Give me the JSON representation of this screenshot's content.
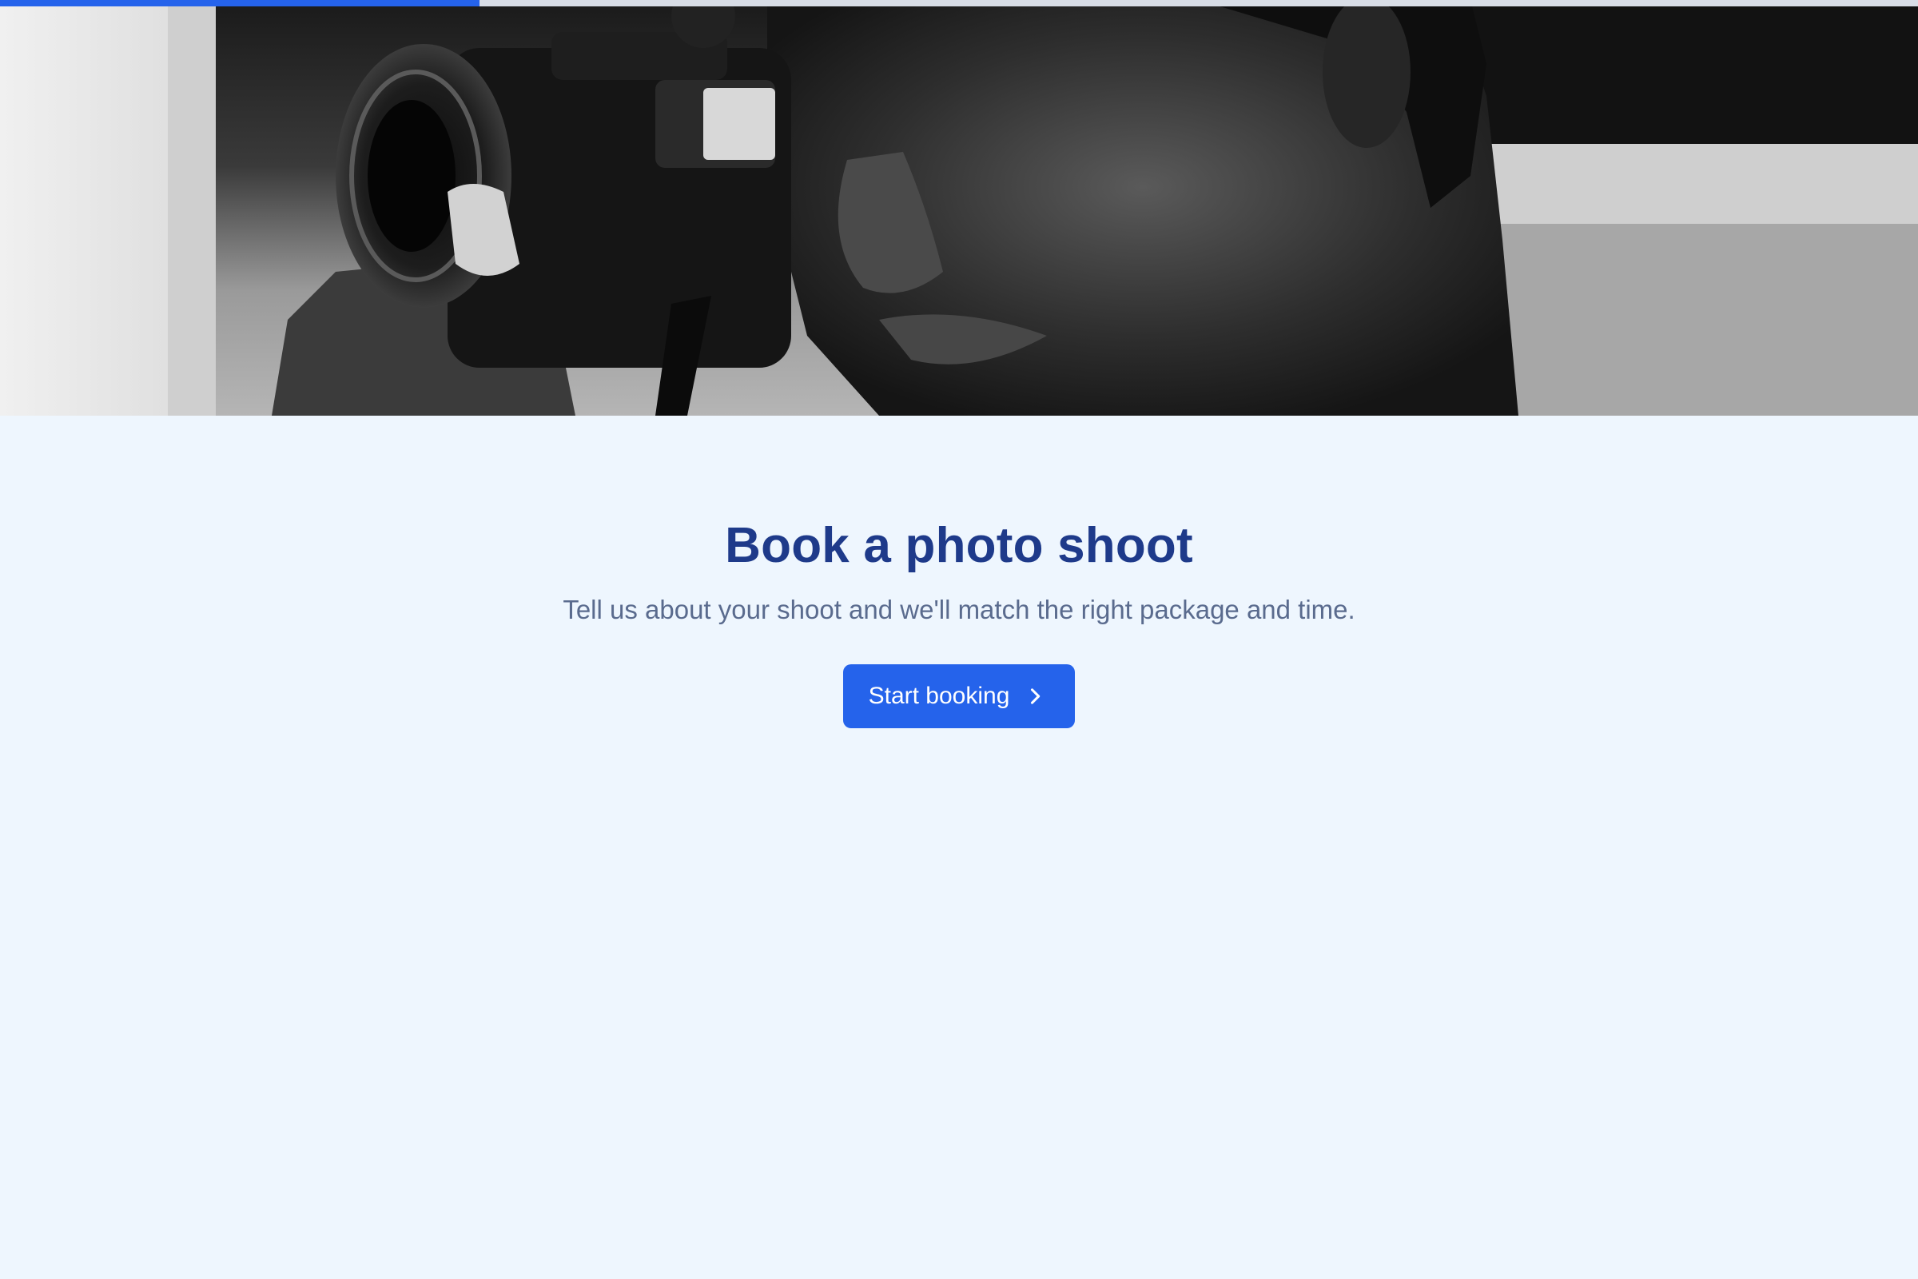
{
  "progress": {
    "fraction": 0.25
  },
  "hero": {
    "image_alt": "photographer holding camera"
  },
  "main": {
    "title": "Book a photo shoot",
    "subtitle": "Tell us about your shoot and we'll match the right package and time.",
    "cta_label": "Start booking",
    "cta_icon": "chevron-right-icon"
  },
  "colors": {
    "accent": "#2563eb",
    "title": "#1e3a8a",
    "subtitle": "#5a6b8e",
    "background": "#eef6fe"
  }
}
